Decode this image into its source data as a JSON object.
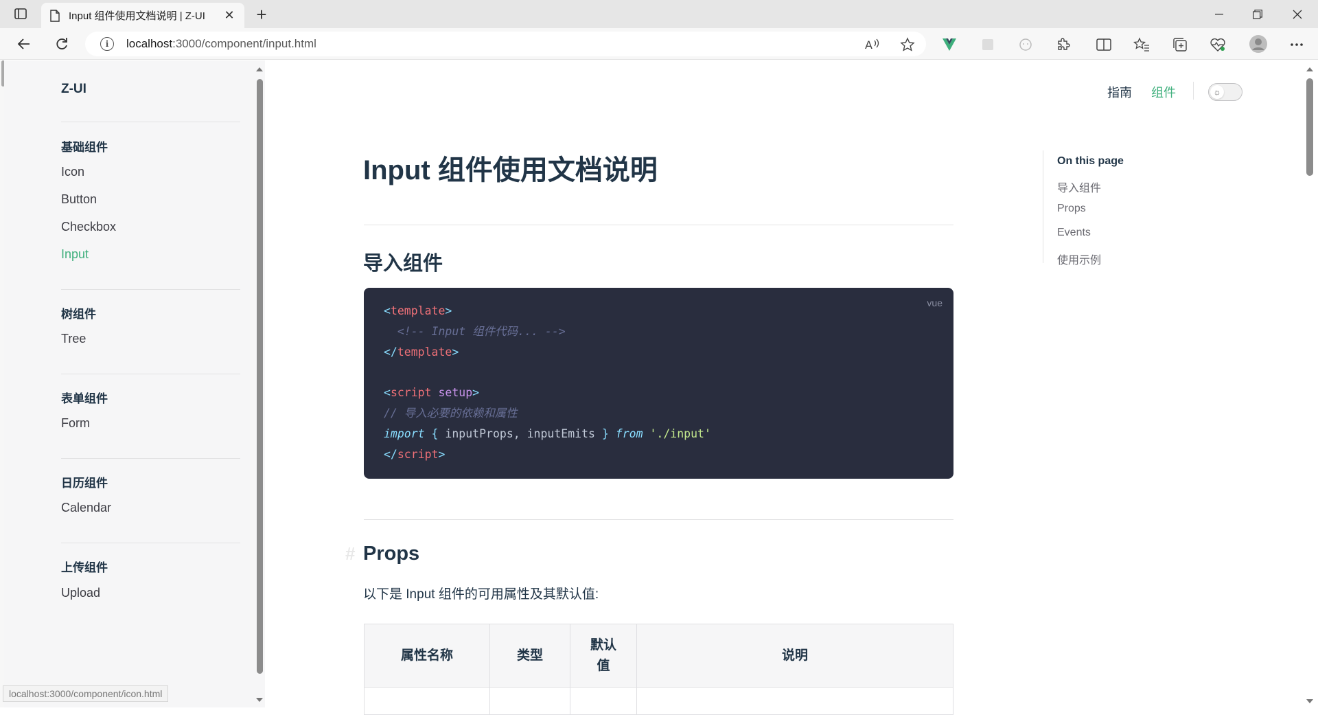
{
  "browser": {
    "tab_title": "Input 组件使用文档说明 | Z-UI",
    "url_host": "localhost",
    "url_path": ":3000/component/input.html",
    "status_url": "localhost:3000/component/icon.html"
  },
  "sidebar": {
    "logo": "Z-UI",
    "groups": [
      {
        "title": "基础组件",
        "items": [
          "Icon",
          "Button",
          "Checkbox",
          "Input"
        ]
      },
      {
        "title": "树组件",
        "items": [
          "Tree"
        ]
      },
      {
        "title": "表单组件",
        "items": [
          "Form"
        ]
      },
      {
        "title": "日历组件",
        "items": [
          "Calendar"
        ]
      },
      {
        "title": "上传组件",
        "items": [
          "Upload"
        ]
      }
    ],
    "active_item": "Input"
  },
  "topnav": {
    "guide": "指南",
    "components": "组件"
  },
  "content": {
    "h1": "Input 组件使用文档说明",
    "h2_import": "导入组件",
    "code_lang": "vue",
    "code": {
      "l1_tag": "template",
      "l2_comment": "<!-- Input 组件代码... -->",
      "l3_tag": "template",
      "l5_tag": "script",
      "l5_attr": "setup",
      "l6_comment": "// 导入必要的依赖和属性",
      "l7_import": "import",
      "l7_names": " inputProps, inputEmits ",
      "l7_from": "from",
      "l7_str": "'./input'",
      "l8_tag": "script"
    },
    "h2_props": "Props",
    "hash": "#",
    "props_intro": "以下是 Input 组件的可用属性及其默认值:",
    "table_headers": [
      "属性名称",
      "类型",
      "默认值",
      "说明"
    ]
  },
  "aside": {
    "title": "On this page",
    "links": [
      "导入组件",
      "Props",
      "Events",
      "使用示例"
    ]
  },
  "colors": {
    "accent": "#3eaf7c",
    "code_bg": "#292d3e",
    "sidebar_bg": "#f6f6f7"
  }
}
